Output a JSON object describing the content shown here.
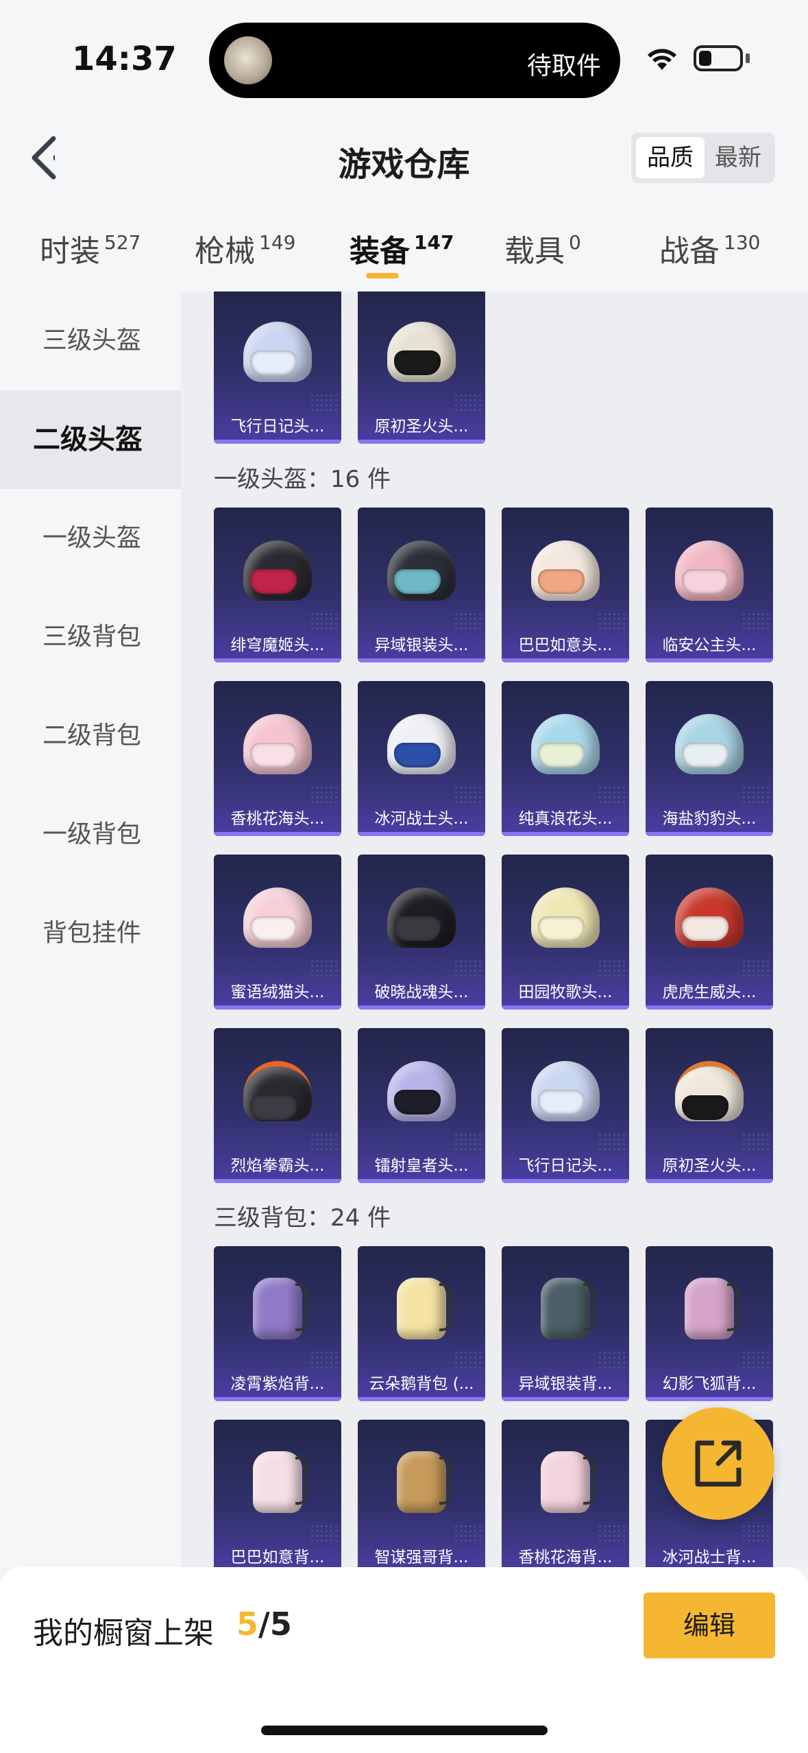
{
  "status_bar": {
    "time": "14:37",
    "island_text": "待取件"
  },
  "header": {
    "title": "游戏仓库",
    "sort_options": [
      "品质",
      "最新"
    ]
  },
  "tabs": [
    {
      "label": "时装",
      "count": "527"
    },
    {
      "label": "枪械",
      "count": "149"
    },
    {
      "label": "装备",
      "count": "147"
    },
    {
      "label": "载具",
      "count": "0"
    },
    {
      "label": "战备",
      "count": "130"
    }
  ],
  "sidebar": {
    "items": [
      "三级头盔",
      "二级头盔",
      "一级头盔",
      "三级背包",
      "二级背包",
      "一级背包",
      "背包挂件"
    ],
    "active": "二级头盔"
  },
  "sections": {
    "level1_helmet_title": "一级头盔：16 件",
    "level3_backpack_title": "三级背包：24 件"
  },
  "level2_helmets_tail": [
    "飞行日记头...",
    "原初圣火头..."
  ],
  "level1_helmets": [
    "绯穹魔姬头...",
    "异域银装头...",
    "巴巴如意头...",
    "临安公主头...",
    "香桃花海头...",
    "冰河战士头...",
    "纯真浪花头...",
    "海盐豹豹头...",
    "蜜语绒猫头...",
    "破晓战魂头...",
    "田园牧歌头...",
    "虎虎生威头...",
    "烈焰拳霸头...",
    "镭射皇者头...",
    "飞行日记头...",
    "原初圣火头..."
  ],
  "level3_backpacks": [
    "凌霄紫焰背...",
    "云朵鹅背包 (...",
    "异域银装背...",
    "幻影飞狐背...",
    "巴巴如意背...",
    "智谋强哥背...",
    "香桃花海背...",
    "冰河战士背..."
  ],
  "bottom_bar": {
    "label": "我的橱窗上架",
    "current": "5",
    "total": "/5",
    "edit_label": "编辑"
  },
  "colors": {
    "accent": "#f5b731",
    "card_bg": "#2c2d5e",
    "card_edge": "#8a74f0"
  },
  "icons": [
    "back-chevron-icon",
    "wifi-icon",
    "battery-icon",
    "share-icon"
  ]
}
